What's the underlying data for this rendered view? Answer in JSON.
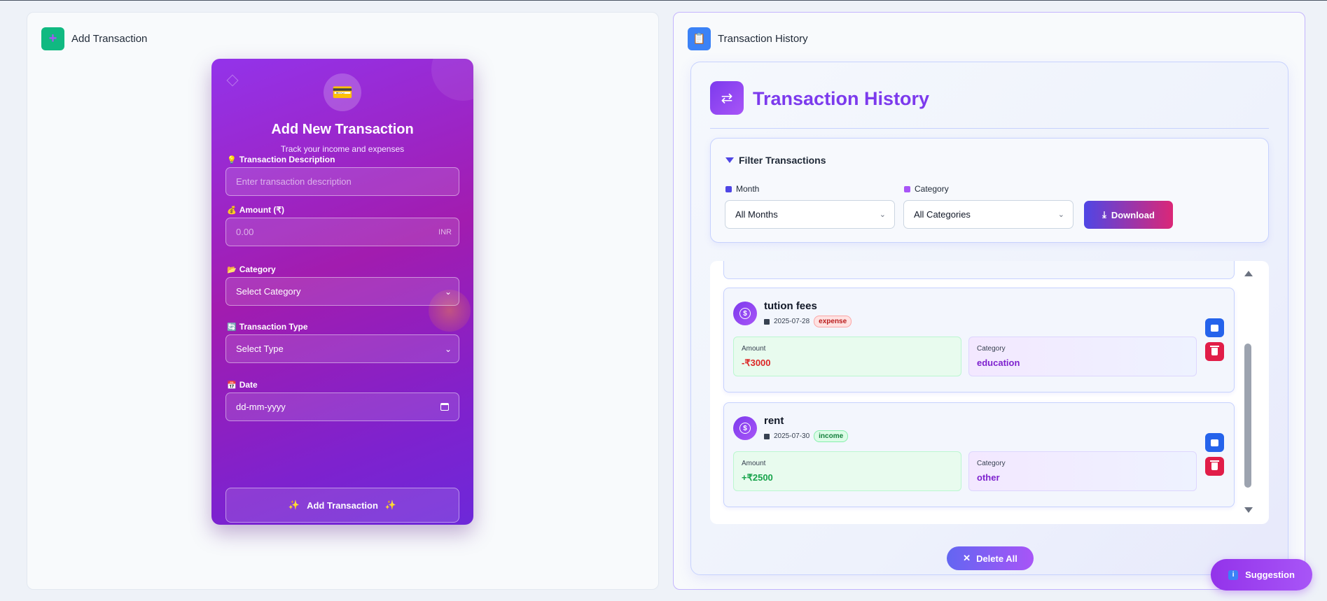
{
  "left_panel": {
    "title": "Add Transaction",
    "icon": "plus-icon"
  },
  "form": {
    "title": "Add New Transaction",
    "subtitle": "Track your income and expenses",
    "badge_icon": "credit-card-icon",
    "description": {
      "label": "Transaction Description",
      "placeholder": "Enter transaction description"
    },
    "amount": {
      "label": "Amount (₹)",
      "placeholder": "0.00",
      "suffix": "INR"
    },
    "category": {
      "label": "Category",
      "value": "Select Category"
    },
    "type": {
      "label": "Transaction Type",
      "value": "Select Type"
    },
    "date": {
      "label": "Date",
      "placeholder": "dd-mm-yyyy"
    },
    "submit_label": "Add Transaction",
    "sparkle": "✨"
  },
  "right_panel": {
    "title": "Transaction History",
    "icon": "clipboard-icon"
  },
  "history": {
    "title": "Transaction History",
    "filter": {
      "title": "Filter Transactions",
      "month_label": "Month",
      "month_value": "All Months",
      "category_label": "Category",
      "category_value": "All Categories",
      "download_label": "Download"
    },
    "transactions": [
      {
        "name": "tution fees",
        "date": "2025-07-28",
        "type": "expense",
        "amount_label": "Amount",
        "amount": "-₹3000",
        "category_label": "Category",
        "category": "education"
      },
      {
        "name": "rent",
        "date": "2025-07-30",
        "type": "income",
        "amount_label": "Amount",
        "amount": "+₹2500",
        "category_label": "Category",
        "category": "other"
      }
    ],
    "delete_all_label": "Delete All"
  },
  "suggestion_label": "Suggestion",
  "colors": {
    "accent": "#7c3aed",
    "expense": "#dc2626",
    "income": "#16a34a",
    "form_gradient_start": "#9333ea"
  }
}
